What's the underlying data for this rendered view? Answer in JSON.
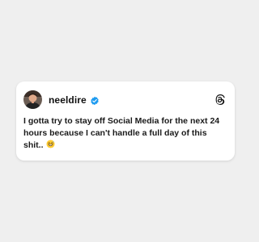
{
  "post": {
    "username": "neeldire",
    "text": "I gotta try to stay off Social Media for the next 24 hours because I can't handle a full day of this shit..",
    "emoji": "😅",
    "verified": true,
    "verified_color": "#1d9bf0"
  },
  "icons": {
    "avatar": "avatar-photo",
    "verified": "verified-badge-icon",
    "platform": "threads-logo-icon",
    "emoji": "grinning-sweat-emoji"
  },
  "colors": {
    "background": "#efefef",
    "card": "#ffffff",
    "text": "#1a1a1a"
  }
}
